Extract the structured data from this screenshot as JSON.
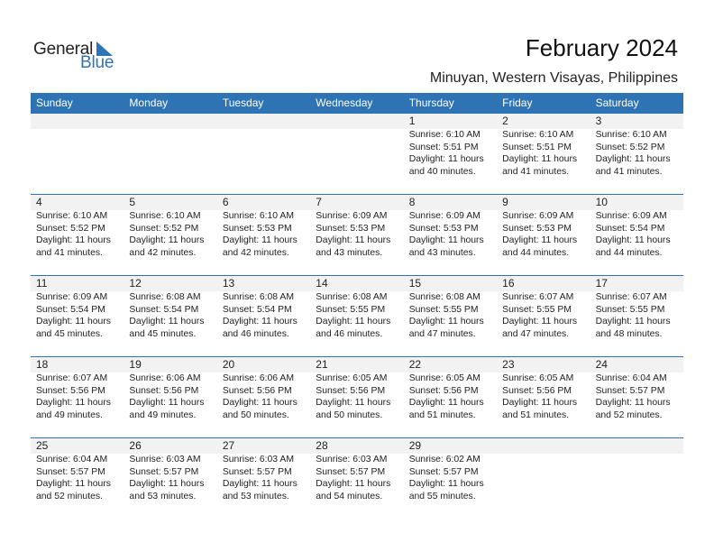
{
  "logo": {
    "general": "General",
    "blue": "Blue",
    "icon": "triangle-logo-icon"
  },
  "title": "February 2024",
  "subtitle": "Minuyan, Western Visayas, Philippines",
  "colors": {
    "accent": "#2e74b5",
    "band": "#f2f2f2"
  },
  "weekdays": [
    "Sunday",
    "Monday",
    "Tuesday",
    "Wednesday",
    "Thursday",
    "Friday",
    "Saturday"
  ],
  "weeks": [
    [
      null,
      null,
      null,
      null,
      {
        "day": "1",
        "sunrise": "Sunrise: 6:10 AM",
        "sunset": "Sunset: 5:51 PM",
        "daylight": "Daylight: 11 hours",
        "minutes": "and 40 minutes."
      },
      {
        "day": "2",
        "sunrise": "Sunrise: 6:10 AM",
        "sunset": "Sunset: 5:51 PM",
        "daylight": "Daylight: 11 hours",
        "minutes": "and 41 minutes."
      },
      {
        "day": "3",
        "sunrise": "Sunrise: 6:10 AM",
        "sunset": "Sunset: 5:52 PM",
        "daylight": "Daylight: 11 hours",
        "minutes": "and 41 minutes."
      }
    ],
    [
      {
        "day": "4",
        "sunrise": "Sunrise: 6:10 AM",
        "sunset": "Sunset: 5:52 PM",
        "daylight": "Daylight: 11 hours",
        "minutes": "and 41 minutes."
      },
      {
        "day": "5",
        "sunrise": "Sunrise: 6:10 AM",
        "sunset": "Sunset: 5:52 PM",
        "daylight": "Daylight: 11 hours",
        "minutes": "and 42 minutes."
      },
      {
        "day": "6",
        "sunrise": "Sunrise: 6:10 AM",
        "sunset": "Sunset: 5:53 PM",
        "daylight": "Daylight: 11 hours",
        "minutes": "and 42 minutes."
      },
      {
        "day": "7",
        "sunrise": "Sunrise: 6:09 AM",
        "sunset": "Sunset: 5:53 PM",
        "daylight": "Daylight: 11 hours",
        "minutes": "and 43 minutes."
      },
      {
        "day": "8",
        "sunrise": "Sunrise: 6:09 AM",
        "sunset": "Sunset: 5:53 PM",
        "daylight": "Daylight: 11 hours",
        "minutes": "and 43 minutes."
      },
      {
        "day": "9",
        "sunrise": "Sunrise: 6:09 AM",
        "sunset": "Sunset: 5:53 PM",
        "daylight": "Daylight: 11 hours",
        "minutes": "and 44 minutes."
      },
      {
        "day": "10",
        "sunrise": "Sunrise: 6:09 AM",
        "sunset": "Sunset: 5:54 PM",
        "daylight": "Daylight: 11 hours",
        "minutes": "and 44 minutes."
      }
    ],
    [
      {
        "day": "11",
        "sunrise": "Sunrise: 6:09 AM",
        "sunset": "Sunset: 5:54 PM",
        "daylight": "Daylight: 11 hours",
        "minutes": "and 45 minutes."
      },
      {
        "day": "12",
        "sunrise": "Sunrise: 6:08 AM",
        "sunset": "Sunset: 5:54 PM",
        "daylight": "Daylight: 11 hours",
        "minutes": "and 45 minutes."
      },
      {
        "day": "13",
        "sunrise": "Sunrise: 6:08 AM",
        "sunset": "Sunset: 5:54 PM",
        "daylight": "Daylight: 11 hours",
        "minutes": "and 46 minutes."
      },
      {
        "day": "14",
        "sunrise": "Sunrise: 6:08 AM",
        "sunset": "Sunset: 5:55 PM",
        "daylight": "Daylight: 11 hours",
        "minutes": "and 46 minutes."
      },
      {
        "day": "15",
        "sunrise": "Sunrise: 6:08 AM",
        "sunset": "Sunset: 5:55 PM",
        "daylight": "Daylight: 11 hours",
        "minutes": "and 47 minutes."
      },
      {
        "day": "16",
        "sunrise": "Sunrise: 6:07 AM",
        "sunset": "Sunset: 5:55 PM",
        "daylight": "Daylight: 11 hours",
        "minutes": "and 47 minutes."
      },
      {
        "day": "17",
        "sunrise": "Sunrise: 6:07 AM",
        "sunset": "Sunset: 5:55 PM",
        "daylight": "Daylight: 11 hours",
        "minutes": "and 48 minutes."
      }
    ],
    [
      {
        "day": "18",
        "sunrise": "Sunrise: 6:07 AM",
        "sunset": "Sunset: 5:56 PM",
        "daylight": "Daylight: 11 hours",
        "minutes": "and 49 minutes."
      },
      {
        "day": "19",
        "sunrise": "Sunrise: 6:06 AM",
        "sunset": "Sunset: 5:56 PM",
        "daylight": "Daylight: 11 hours",
        "minutes": "and 49 minutes."
      },
      {
        "day": "20",
        "sunrise": "Sunrise: 6:06 AM",
        "sunset": "Sunset: 5:56 PM",
        "daylight": "Daylight: 11 hours",
        "minutes": "and 50 minutes."
      },
      {
        "day": "21",
        "sunrise": "Sunrise: 6:05 AM",
        "sunset": "Sunset: 5:56 PM",
        "daylight": "Daylight: 11 hours",
        "minutes": "and 50 minutes."
      },
      {
        "day": "22",
        "sunrise": "Sunrise: 6:05 AM",
        "sunset": "Sunset: 5:56 PM",
        "daylight": "Daylight: 11 hours",
        "minutes": "and 51 minutes."
      },
      {
        "day": "23",
        "sunrise": "Sunrise: 6:05 AM",
        "sunset": "Sunset: 5:56 PM",
        "daylight": "Daylight: 11 hours",
        "minutes": "and 51 minutes."
      },
      {
        "day": "24",
        "sunrise": "Sunrise: 6:04 AM",
        "sunset": "Sunset: 5:57 PM",
        "daylight": "Daylight: 11 hours",
        "minutes": "and 52 minutes."
      }
    ],
    [
      {
        "day": "25",
        "sunrise": "Sunrise: 6:04 AM",
        "sunset": "Sunset: 5:57 PM",
        "daylight": "Daylight: 11 hours",
        "minutes": "and 52 minutes."
      },
      {
        "day": "26",
        "sunrise": "Sunrise: 6:03 AM",
        "sunset": "Sunset: 5:57 PM",
        "daylight": "Daylight: 11 hours",
        "minutes": "and 53 minutes."
      },
      {
        "day": "27",
        "sunrise": "Sunrise: 6:03 AM",
        "sunset": "Sunset: 5:57 PM",
        "daylight": "Daylight: 11 hours",
        "minutes": "and 53 minutes."
      },
      {
        "day": "28",
        "sunrise": "Sunrise: 6:03 AM",
        "sunset": "Sunset: 5:57 PM",
        "daylight": "Daylight: 11 hours",
        "minutes": "and 54 minutes."
      },
      {
        "day": "29",
        "sunrise": "Sunrise: 6:02 AM",
        "sunset": "Sunset: 5:57 PM",
        "daylight": "Daylight: 11 hours",
        "minutes": "and 55 minutes."
      },
      null,
      null
    ]
  ]
}
